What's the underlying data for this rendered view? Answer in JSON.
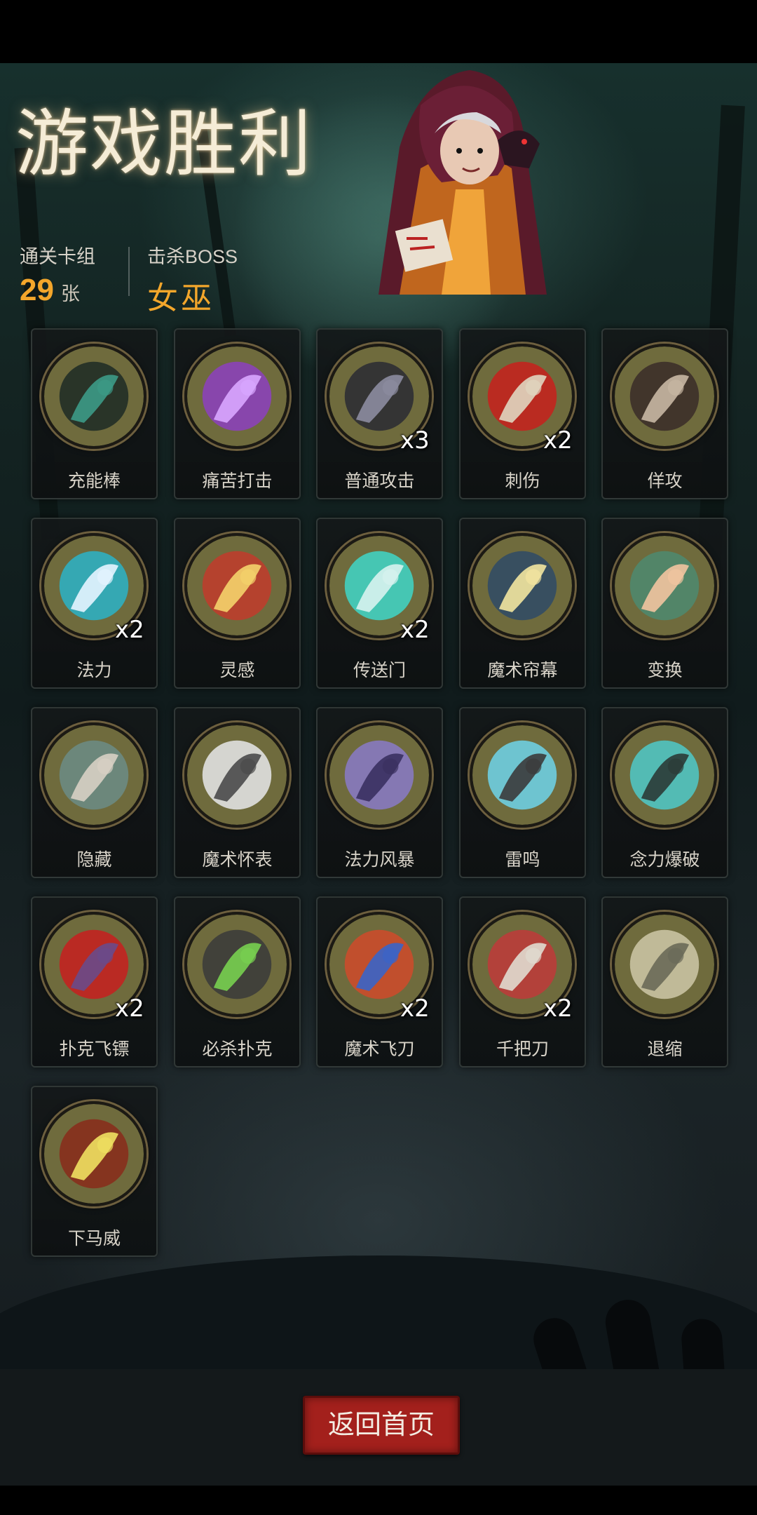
{
  "header": {
    "title": "游戏胜利",
    "cleared_label": "通关卡组",
    "cleared_count": "29",
    "cleared_unit": "张",
    "boss_label": "击杀BOSS",
    "boss_name": "女巫"
  },
  "cards": [
    {
      "name": "充能棒",
      "count": "",
      "icon": "charge-rod-icon"
    },
    {
      "name": "痛苦打击",
      "count": "",
      "icon": "pain-strike-icon"
    },
    {
      "name": "普通攻击",
      "count": "x3",
      "icon": "normal-attack-icon"
    },
    {
      "name": "刺伤",
      "count": "x2",
      "icon": "stab-icon"
    },
    {
      "name": "佯攻",
      "count": "",
      "icon": "feint-icon"
    },
    {
      "name": "法力",
      "count": "x2",
      "icon": "mana-icon"
    },
    {
      "name": "灵感",
      "count": "",
      "icon": "inspiration-icon"
    },
    {
      "name": "传送门",
      "count": "x2",
      "icon": "portal-icon"
    },
    {
      "name": "魔术帘幕",
      "count": "",
      "icon": "magic-curtain-icon"
    },
    {
      "name": "变换",
      "count": "",
      "icon": "transform-icon"
    },
    {
      "name": "隐藏",
      "count": "",
      "icon": "hide-icon"
    },
    {
      "name": "魔术怀表",
      "count": "",
      "icon": "pocket-watch-icon"
    },
    {
      "name": "法力风暴",
      "count": "",
      "icon": "mana-storm-icon"
    },
    {
      "name": "雷鸣",
      "count": "",
      "icon": "thunder-icon"
    },
    {
      "name": "念力爆破",
      "count": "",
      "icon": "psychic-blast-icon"
    },
    {
      "name": "扑克飞镖",
      "count": "x2",
      "icon": "poker-dart-icon"
    },
    {
      "name": "必杀扑克",
      "count": "",
      "icon": "killer-poker-icon"
    },
    {
      "name": "魔术飞刀",
      "count": "x2",
      "icon": "magic-knife-icon"
    },
    {
      "name": "千把刀",
      "count": "x2",
      "icon": "thousand-knives-icon"
    },
    {
      "name": "退缩",
      "count": "",
      "icon": "retreat-icon"
    },
    {
      "name": "下马威",
      "count": "",
      "icon": "intimidate-icon"
    }
  ],
  "footer": {
    "home_button": "返回首页"
  },
  "colors": {
    "accent": "#f3a62b",
    "button": "#a3201c",
    "icon_bg": "#6f6b3d"
  }
}
